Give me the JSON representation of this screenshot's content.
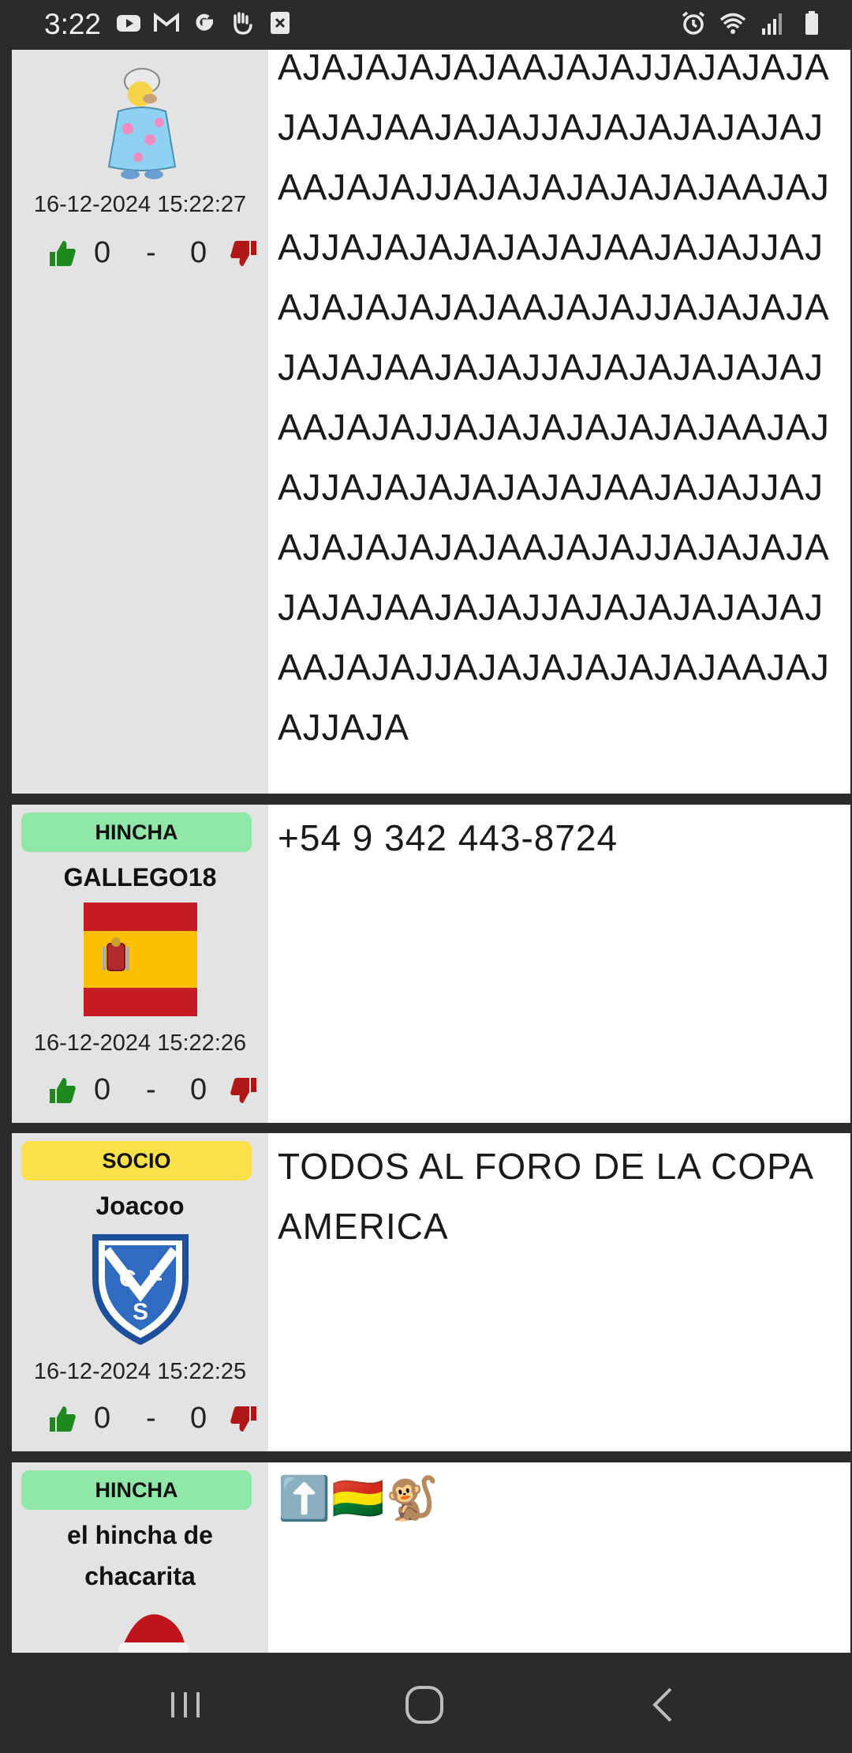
{
  "status_bar": {
    "time": "3:22",
    "left_icons": [
      "youtube-icon",
      "gmail-icon",
      "google-icon",
      "hand-icon",
      "close-box-icon"
    ],
    "right_icons": [
      "alarm-icon",
      "wifi-icon",
      "signal-icon",
      "battery-icon"
    ]
  },
  "posts": [
    {
      "timestamp": "16-12-2024 15:22:27",
      "upvotes": "0",
      "separator": "-",
      "downvotes": "0",
      "text": "AJAJAJAJAJAAJAJAJJAJAJAJAJAJAJAAJAJAJJAJAJAJAJAJAJAAJAJAJJAJAJAJAJAJAJAAJAJAJJAJAJAJAJAJAJAAJAJAJJAJAJAJAJAJAJAAJAJAJJAJAJAJAJAJAJAAJAJAJJAJAJAJAJAJAJAAJAJAJJAJAJAJAJAJAJAAJAJAJJAJAJAJAJAJAJAAJAJAJJAJAJAJAJAJAJAAJAJAJJAJAJAJAJAJAJAAJAJAJJAJAJAJAJAJAJAAJAJAJJAJAJAJAJAJAJAAJAJAJJAJA"
    },
    {
      "badge": "HINCHA",
      "username": "GALLEGO18",
      "timestamp": "16-12-2024 15:22:26",
      "upvotes": "0",
      "separator": "-",
      "downvotes": "0",
      "text": "+54 9 342 443-8724"
    },
    {
      "badge": "SOCIO",
      "username": "Joacoo",
      "timestamp": "16-12-2024 15:22:25",
      "upvotes": "0",
      "separator": "-",
      "downvotes": "0",
      "text": "TODOS AL FORO DE LA COPA AMERICA"
    },
    {
      "badge": "HINCHA",
      "username": "el hincha de chacarita",
      "text": "⬆️🇧🇴🐒"
    }
  ],
  "colors": {
    "hincha_badge": "#8fe8a8",
    "socio_badge": "#fbe04a",
    "thumb_up": "#1e8a1e",
    "thumb_down": "#b01818"
  }
}
